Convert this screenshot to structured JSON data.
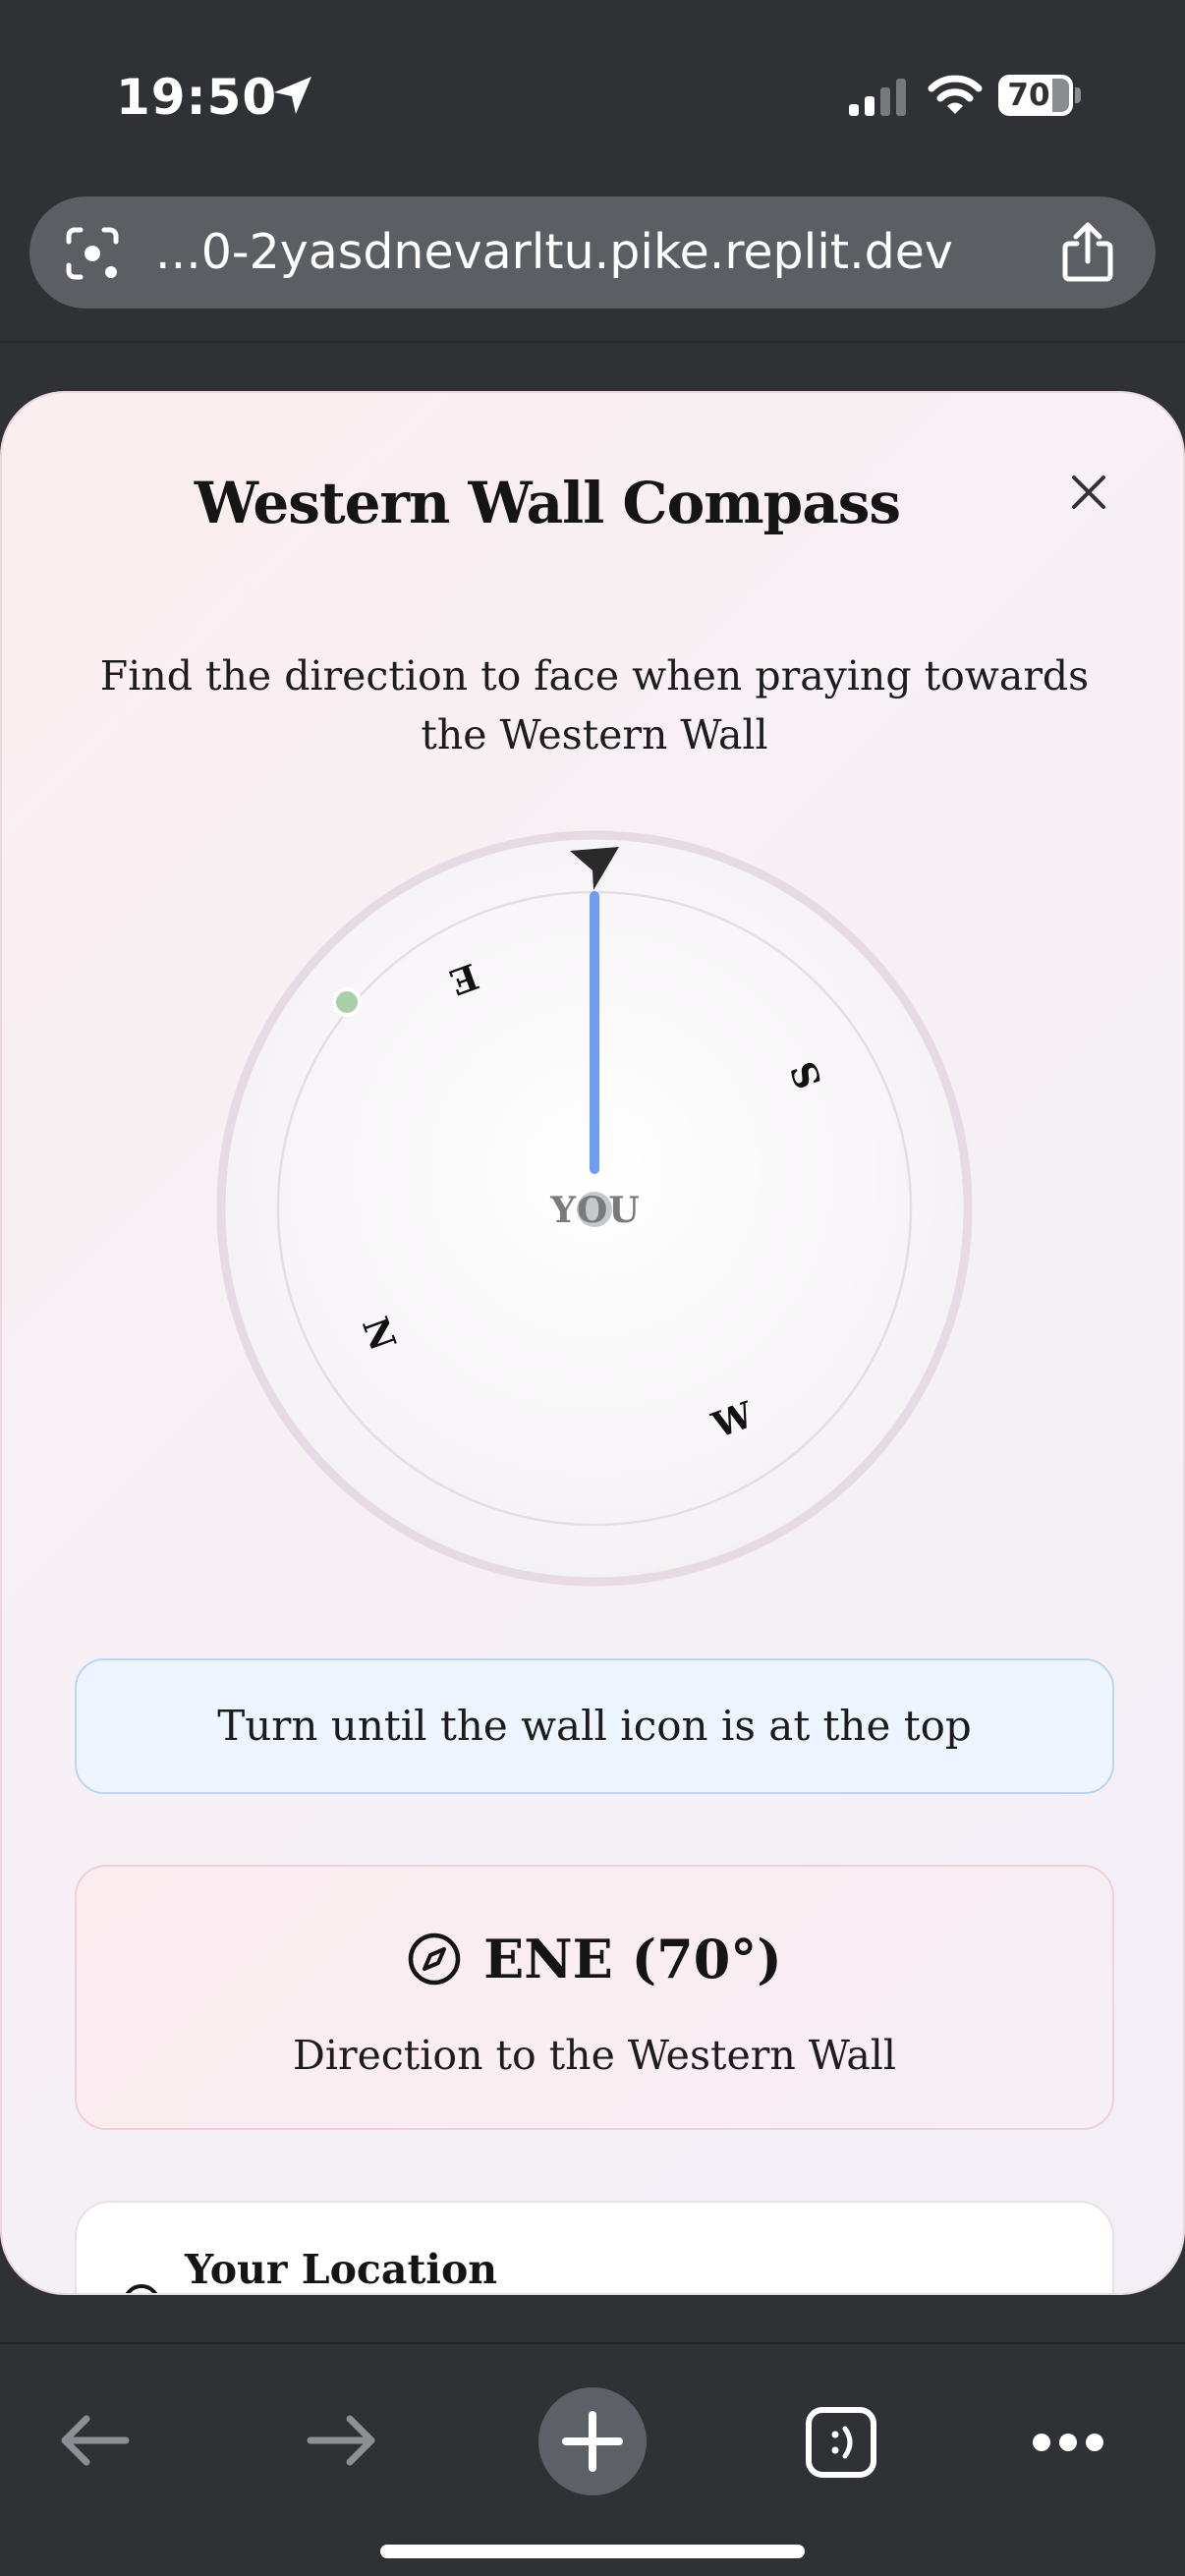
{
  "status_bar": {
    "time": "19:50",
    "battery": "70",
    "icons": [
      "location-arrow-icon",
      "signal-icon",
      "wifi-icon",
      "battery-icon"
    ]
  },
  "browser": {
    "url": "...0-2yasdnevarltu.pike.replit.dev",
    "icons": [
      "lens-icon",
      "share-icon"
    ]
  },
  "modal": {
    "title": "Western Wall Compass",
    "subtitle": "Find the direction to face when praying towards the Western Wall",
    "compass": {
      "directions": {
        "north": "N",
        "east": "E",
        "south": "S",
        "west": "W"
      },
      "center_label": "YOU",
      "heading_deg": 70,
      "colors": {
        "needle": "#6f9cf0",
        "target_dot": "#a8cfa8",
        "ring": "#e7dde6"
      }
    },
    "hint": "Turn until the wall icon is at the top",
    "direction": {
      "value": "ENE (70°)",
      "caption": "Direction to the Western Wall"
    },
    "location": {
      "title": "Your Location"
    }
  },
  "toolbar": {
    "icons": [
      "back-arrow-icon",
      "forward-arrow-icon",
      "plus-icon",
      "tabs-icon",
      "more-icon"
    ]
  }
}
